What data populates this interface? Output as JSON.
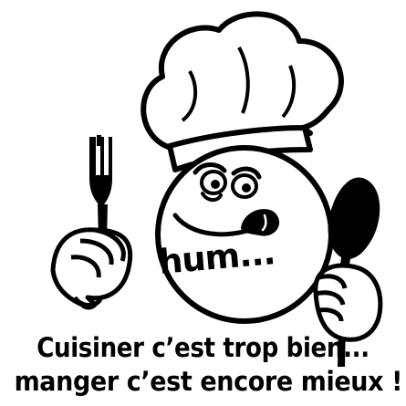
{
  "artwork": {
    "speech_text": "hum...",
    "caption_line1": "Cuisiner c’est trop bien...",
    "caption_line2": "manger c’est encore mieux !",
    "ink_color": "#000000",
    "background_color": "#ffffff",
    "elements": [
      "chef-hat-icon",
      "chef-face-icon",
      "fork-icon",
      "spoon-icon",
      "hand-icon"
    ]
  }
}
